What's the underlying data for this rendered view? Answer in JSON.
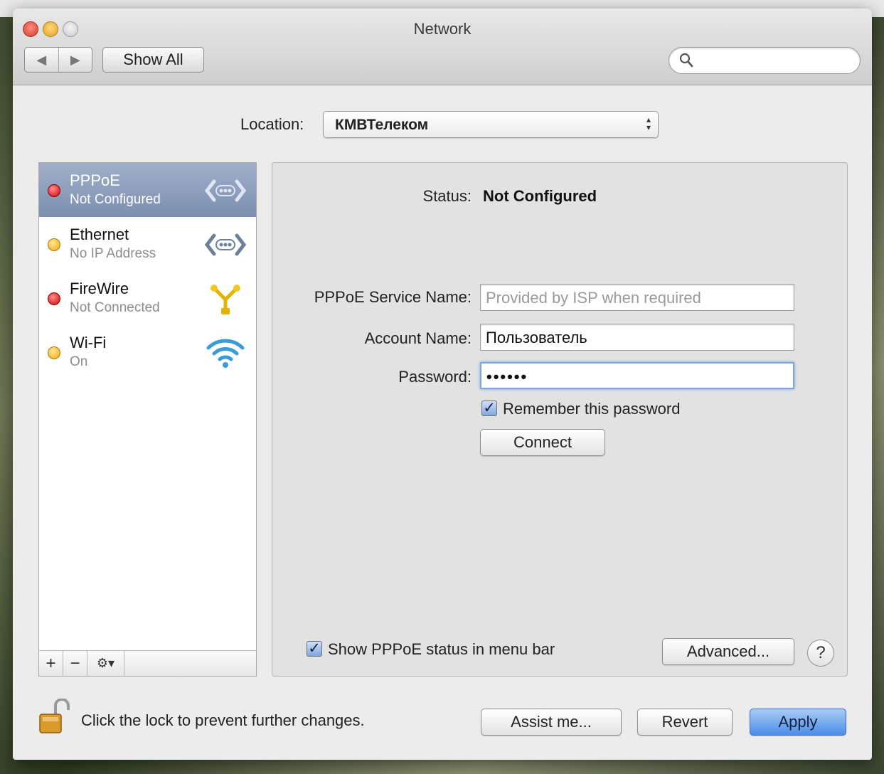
{
  "window": {
    "title": "Network"
  },
  "toolbar": {
    "back_icon": "◀",
    "forward_icon": "▶",
    "show_all_label": "Show All",
    "search_placeholder": ""
  },
  "location": {
    "label": "Location:",
    "value": "КМВТелеком"
  },
  "services": [
    {
      "name": "PPPoE",
      "status": "Not Configured",
      "dot": "red",
      "icon": "ethernet-icon",
      "selected": true
    },
    {
      "name": "Ethernet",
      "status": "No IP Address",
      "dot": "yellow",
      "icon": "ethernet-icon",
      "selected": false
    },
    {
      "name": "FireWire",
      "status": "Not Connected",
      "dot": "red",
      "icon": "firewire-icon",
      "selected": false
    },
    {
      "name": "Wi-Fi",
      "status": "On",
      "dot": "yellow",
      "icon": "wifi-icon",
      "selected": false
    }
  ],
  "sidebar_footer": {
    "add": "+",
    "remove": "−",
    "gear": "⚙▾"
  },
  "detail": {
    "status_label": "Status:",
    "status_value": "Not Configured",
    "service_name_label": "PPPoE Service Name:",
    "service_name_placeholder": "Provided by ISP when required",
    "account_label": "Account Name:",
    "account_value": "Пользователь",
    "password_label": "Password:",
    "password_value": "••••••",
    "remember_label": "Remember this password",
    "remember_checked": true,
    "connect_label": "Connect",
    "show_status_label": "Show PPPoE status in menu bar",
    "show_status_checked": true,
    "advanced_label": "Advanced...",
    "help_label": "?"
  },
  "footer": {
    "lock_text": "Click the lock to prevent further changes.",
    "assist_label": "Assist me...",
    "revert_label": "Revert",
    "apply_label": "Apply"
  },
  "colors": {
    "accent": "#4b8ee8",
    "selection": "#8c9dbd",
    "red_status": "#d10000",
    "yellow_status": "#eea800"
  }
}
